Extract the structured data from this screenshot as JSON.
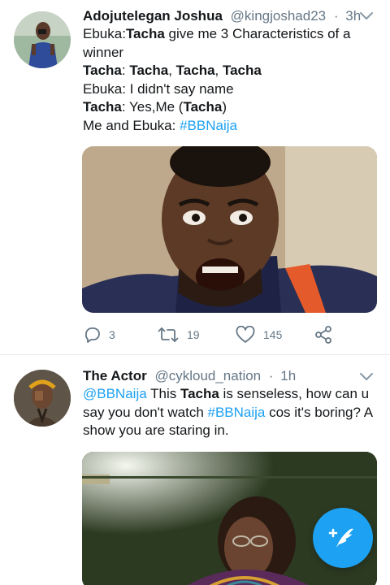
{
  "colors": {
    "link": "#1da1f2",
    "muted": "#657786",
    "text": "#14171a",
    "fab": "#1da1f2"
  },
  "tweets": [
    {
      "name": "Adojutelegan Joshua",
      "handle": "@kingjoshad23",
      "dot": "·",
      "time": "3h",
      "lines": [
        [
          {
            "t": "Ebuka:"
          },
          {
            "t": "Tacha",
            "b": true
          },
          {
            "t": " give me 3 Characteristics of a"
          }
        ],
        [
          {
            "t": "winner"
          }
        ],
        [
          {
            "t": "Tacha",
            "b": true
          },
          {
            "t": ": "
          },
          {
            "t": "Tacha",
            "b": true
          },
          {
            "t": ", "
          },
          {
            "t": "Tacha",
            "b": true
          },
          {
            "t": ", "
          },
          {
            "t": "Tacha",
            "b": true
          }
        ],
        [
          {
            "t": "Ebuka: I didn't say name"
          }
        ],
        [
          {
            "t": "Tacha",
            "b": true
          },
          {
            "t": ": Yes,Me ("
          },
          {
            "t": "Tacha",
            "b": true
          },
          {
            "t": ")"
          }
        ],
        [
          {
            "t": "Me and Ebuka:  "
          },
          {
            "t": "#BBNaija",
            "link": true
          }
        ]
      ],
      "actions": {
        "reply_count": "3",
        "retweet_count": "19",
        "like_count": "145"
      },
      "icons": {
        "reply": "reply-icon",
        "retweet": "retweet-icon",
        "like": "heart-icon",
        "share": "share-icon",
        "menu": "chevron-down-icon"
      }
    },
    {
      "name": "The Actor",
      "handle": "@cykloud_nation",
      "dot": "·",
      "time": "1h",
      "lines": [
        [
          {
            "t": "@BBNaija",
            "link": true
          },
          {
            "t": " This "
          },
          {
            "t": "Tacha",
            "b": true
          },
          {
            "t": " is senseless, how can u"
          }
        ],
        [
          {
            "t": "say you don't watch "
          },
          {
            "t": "#BBNaija",
            "link": true
          },
          {
            "t": " cos it's boring? A"
          }
        ],
        [
          {
            "t": "show you are staring in."
          }
        ]
      ],
      "icons": {
        "menu": "chevron-down-icon"
      }
    }
  ],
  "fab": {
    "icon": "compose-tweet-icon"
  }
}
